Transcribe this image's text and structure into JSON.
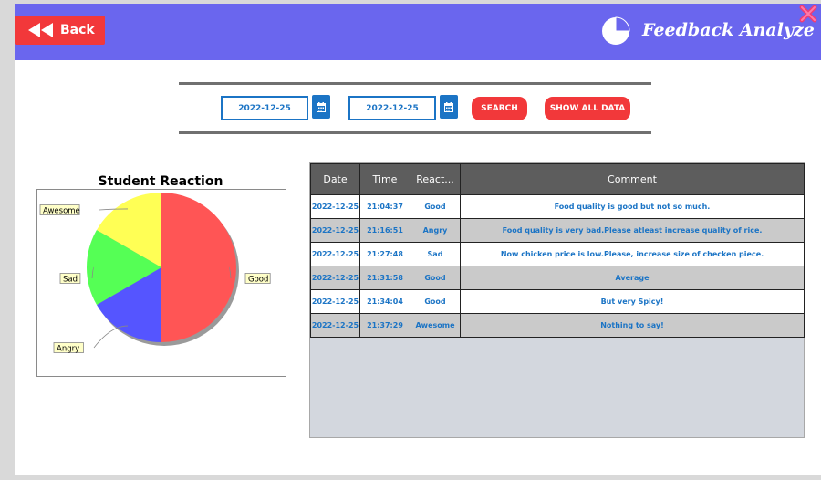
{
  "header": {
    "back_label": "Back",
    "title": "Feedback Analyze",
    "color": "#6a66ee"
  },
  "filter": {
    "from_date": "2022-12-25",
    "to_date": "2022-12-25",
    "search_label": "SEARCH",
    "show_all_label": "SHOW ALL DATA"
  },
  "chart_data": {
    "type": "pie",
    "title": "Student Reaction",
    "slices": [
      {
        "label": "Good",
        "value": 3,
        "color": "#ff5555"
      },
      {
        "label": "Angry",
        "value": 1,
        "color": "#5555ff"
      },
      {
        "label": "Sad",
        "value": 1,
        "color": "#55ff55"
      },
      {
        "label": "Awesome",
        "value": 1,
        "color": "#ffff55"
      }
    ]
  },
  "table": {
    "columns": [
      "Date",
      "Time",
      "React...",
      "Comment"
    ],
    "rows": [
      [
        "2022-12-25",
        "21:04:37",
        "Good",
        "Food quality is good but not so much."
      ],
      [
        "2022-12-25",
        "21:16:51",
        "Angry",
        "Food quality is very bad.Please atleast increase quality of rice."
      ],
      [
        "2022-12-25",
        "21:27:48",
        "Sad",
        "Now chicken price is low.Please, increase size of checken piece."
      ],
      [
        "2022-12-25",
        "21:31:58",
        "Good",
        "Average"
      ],
      [
        "2022-12-25",
        "21:34:04",
        "Good",
        "But very Spicy!"
      ],
      [
        "2022-12-25",
        "21:37:29",
        "Awesome",
        "Nothing to say!"
      ]
    ]
  }
}
